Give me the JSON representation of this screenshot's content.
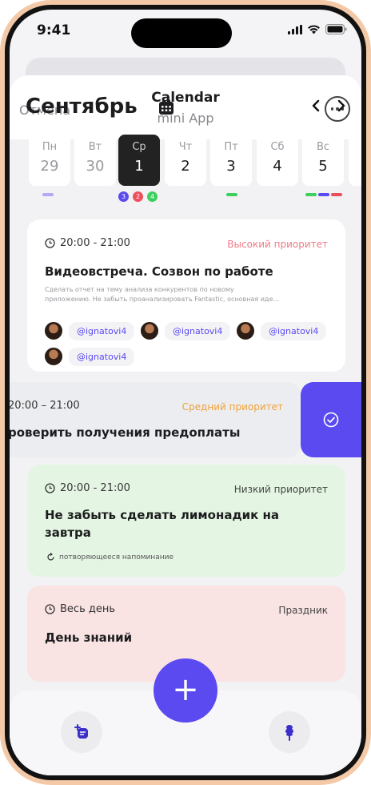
{
  "status": {
    "time": "9:41"
  },
  "header": {
    "cancel": "Отмена",
    "title": "Calendar",
    "subtitle": "mini App"
  },
  "calendar": {
    "month": "Сентябрь",
    "days": [
      {
        "name": "Пн",
        "date": "29"
      },
      {
        "name": "Вт",
        "date": "30"
      },
      {
        "name": "Ср",
        "date": "1"
      },
      {
        "name": "Чт",
        "date": "2"
      },
      {
        "name": "Пт",
        "date": "3"
      },
      {
        "name": "Сб",
        "date": "4"
      },
      {
        "name": "Вс",
        "date": "5"
      }
    ],
    "badges": [
      "3",
      "2",
      "4"
    ]
  },
  "colors": {
    "accent": "#5a4af0",
    "high": "#f07a86",
    "medium": "#f0a238",
    "low": "#3fcf5e"
  },
  "events": [
    {
      "time": "20:00 - 21:00",
      "priority": "Высокий приоритет",
      "title": "Видеовстреча. Созвон по работе",
      "desc_line1": "Сделать отчет на тему анализа конкурентов по новому",
      "desc_line2": "приложению. Не забыть проанализировать Fantastic, основная иде...",
      "users": [
        "@ignatovi4",
        "@ignatovi4",
        "@ignatovi4",
        "@ignatovi4"
      ]
    },
    {
      "time": "20:00 – 21:00",
      "priority": "Средний приоритет",
      "title": "роверить получения предоплаты"
    },
    {
      "time": "20:00 - 21:00",
      "priority": "Низкий приоритет",
      "title_line1": "Не забыть сделать лимонадик на",
      "title_line2": "завтра",
      "reminder": "потворяющееся напоминание"
    },
    {
      "time": "Весь день",
      "priority": "Праздник",
      "title": "День знаний"
    }
  ],
  "fab_label": "+"
}
